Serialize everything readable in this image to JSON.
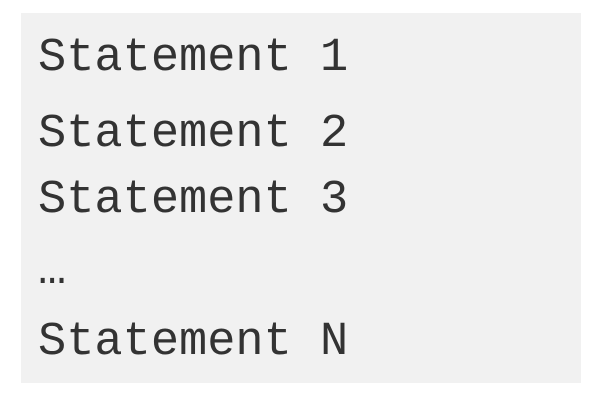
{
  "code_block": {
    "lines": [
      "Statement 1",
      "Statement 2",
      "Statement 3",
      "…",
      "Statement N"
    ]
  }
}
